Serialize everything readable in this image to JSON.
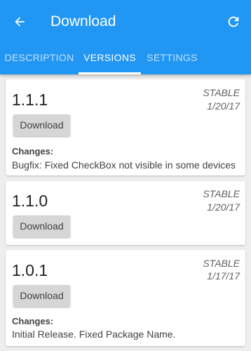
{
  "toolbar": {
    "title": "Download",
    "back_icon": "arrow-back-icon",
    "refresh_icon": "refresh-icon"
  },
  "tabs": [
    {
      "label": "DESCRIPTION",
      "active": false
    },
    {
      "label": "VERSIONS",
      "active": true
    },
    {
      "label": "SETTINGS",
      "active": false
    }
  ],
  "versions": [
    {
      "version": "1.1.1",
      "channel": "STABLE",
      "date": "1/20/17",
      "button_label": "Download",
      "changes_label": "Changes:",
      "changes_text": "Bugfix: Fixed CheckBox not visible in some devices"
    },
    {
      "version": "1.1.0",
      "channel": "STABLE",
      "date": "1/20/17",
      "button_label": "Download"
    },
    {
      "version": "1.0.1",
      "channel": "STABLE",
      "date": "1/17/17",
      "button_label": "Download",
      "changes_label": "Changes:",
      "changes_text": "Initial Release. Fixed Package Name."
    }
  ],
  "colors": {
    "primary": "#2196f3",
    "background": "#eeeeee",
    "button": "#d6d6d6"
  }
}
